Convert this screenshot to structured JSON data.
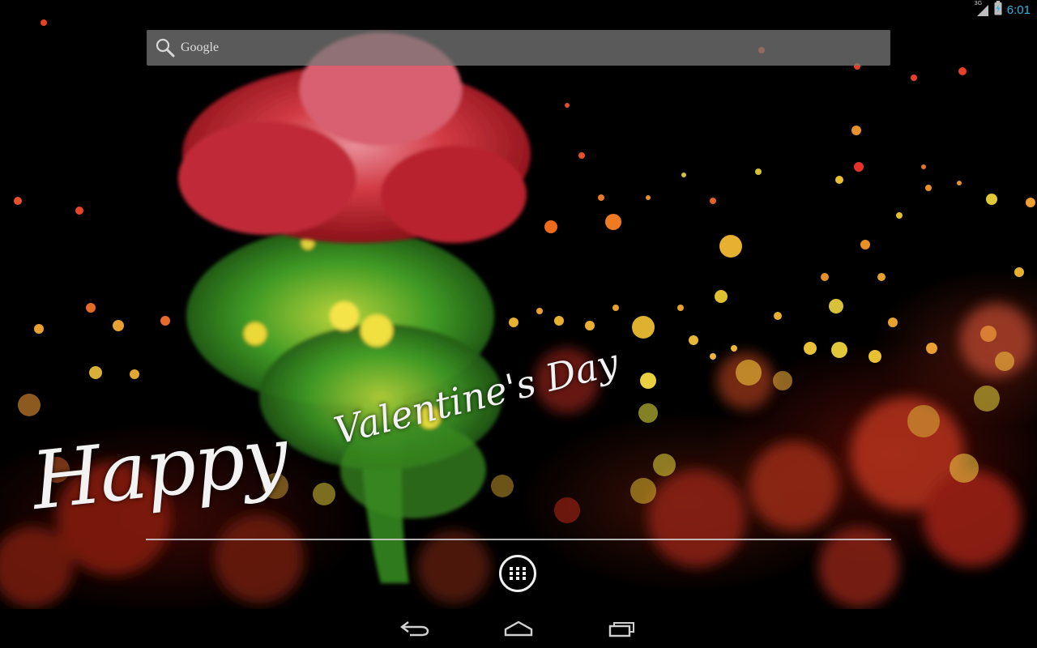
{
  "status_bar": {
    "network_label": "3G",
    "time": "6:01",
    "icons": [
      "signal-icon",
      "battery-charging-icon"
    ],
    "time_color": "#33b5e5"
  },
  "search_bar": {
    "label": "Google",
    "icon": "search-icon"
  },
  "wallpaper": {
    "greeting_line1": "Happy",
    "greeting_line2": "Valentine's Day"
  },
  "dock": {
    "all_apps_icon": "app-grid-icon"
  },
  "nav_bar": {
    "buttons": [
      "back-icon",
      "home-icon",
      "recent-apps-icon"
    ]
  }
}
